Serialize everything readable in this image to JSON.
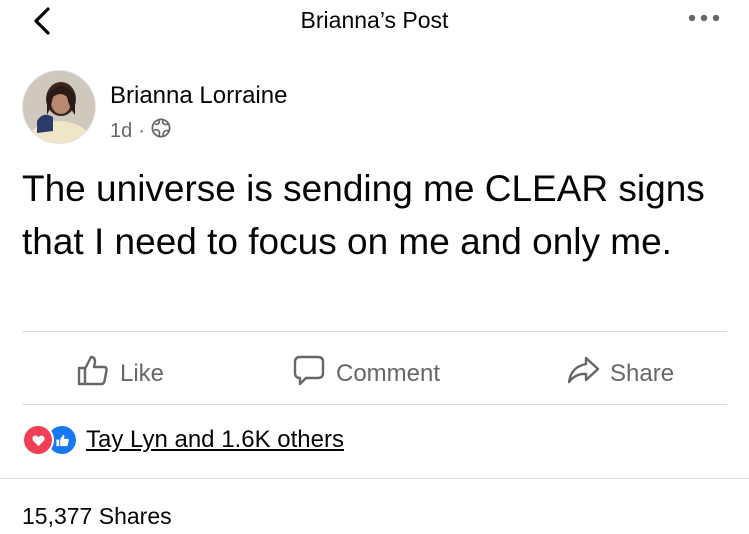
{
  "header": {
    "title": "Brianna’s Post",
    "back_icon": "chevron-left-icon",
    "more_icon": "more-dots-icon"
  },
  "post": {
    "author": "Brianna Lorraine",
    "time": "1d",
    "separator": "·",
    "privacy_icon": "globe-icon",
    "text": "The universe is sending me CLEAR signs that I need to focus on me and only me."
  },
  "actions": {
    "like": "Like",
    "comment": "Comment",
    "share": "Share"
  },
  "reactions": {
    "icons": [
      "love-reaction-icon",
      "like-reaction-icon"
    ],
    "summary": "Tay Lyn and 1.6K others"
  },
  "shares": {
    "label": "15,377 Shares"
  },
  "colors": {
    "secondary_text": "#65676b",
    "like_blue": "#1877f2",
    "love_red": "#f33e58",
    "divider": "#dadde1"
  }
}
